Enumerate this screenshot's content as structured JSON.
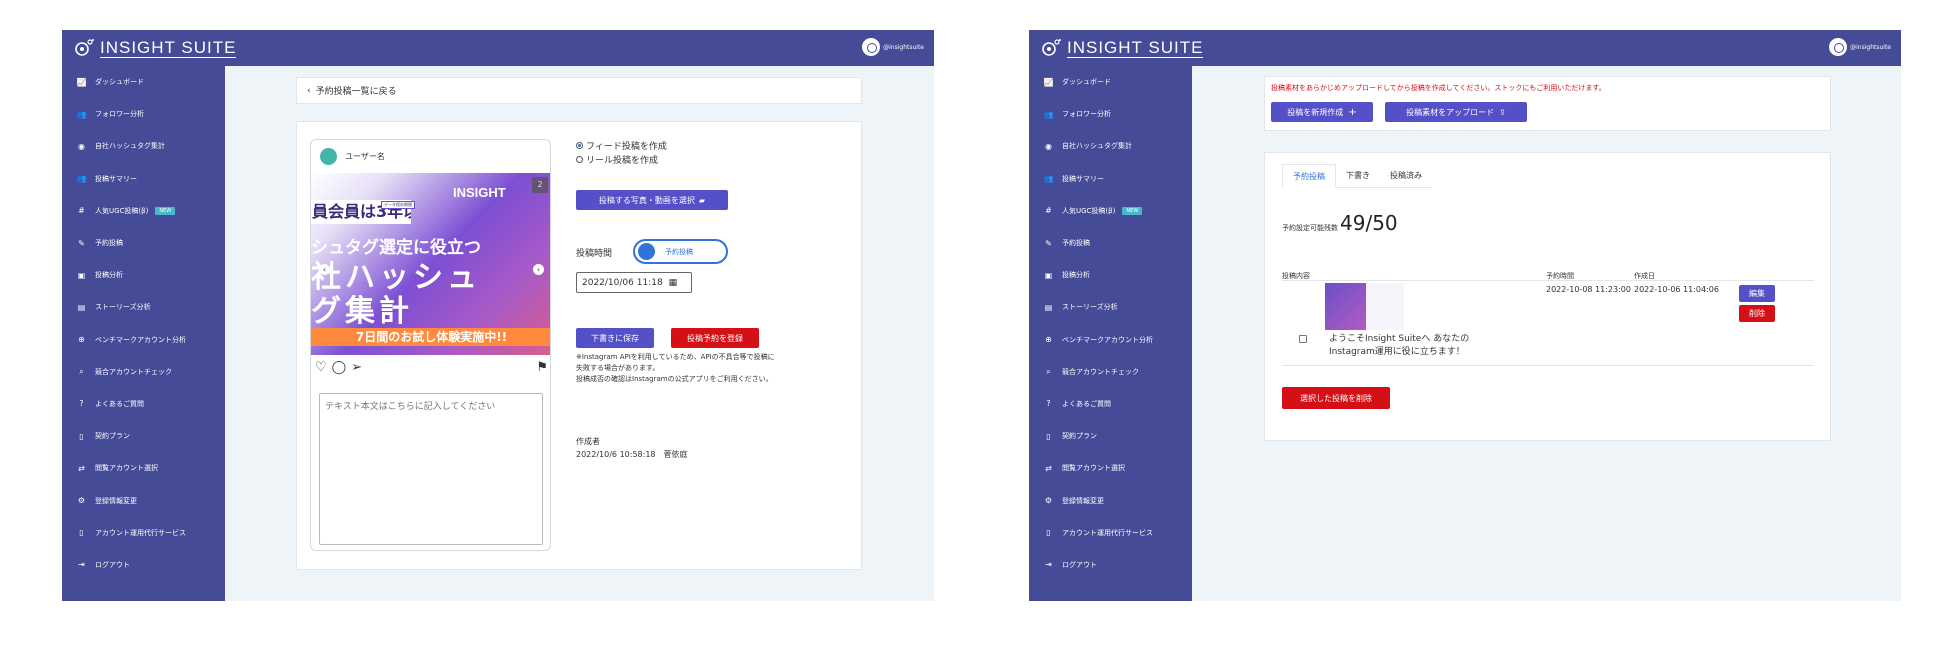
{
  "brand": {
    "logo_text": "INSIGHT SUITE",
    "username": "@insightsuite"
  },
  "colors": {
    "sidebar": "#454b96",
    "primary": "#5350c8",
    "danger": "#d40f16",
    "link": "#2f74d6",
    "bg": "#eef4f8"
  },
  "sidebar": {
    "items": [
      {
        "icon": "chart-line-icon",
        "label": "ダッシュボード"
      },
      {
        "icon": "users-icon",
        "label": "フォロワー分析"
      },
      {
        "icon": "user-circle-icon",
        "label": "自社ハッシュタグ集計"
      },
      {
        "icon": "users-icon",
        "label": "投稿サマリー"
      },
      {
        "icon": "hashtag-icon",
        "label": "人気UGC投稿(β)",
        "badge": "NEW"
      },
      {
        "icon": "edit-icon",
        "label": "予約投稿"
      },
      {
        "icon": "images-icon",
        "label": "投稿分析"
      },
      {
        "icon": "file-icon",
        "label": "ストーリーズ分析"
      },
      {
        "icon": "search-plus-icon",
        "label": "ベンチマークアカウント分析"
      },
      {
        "icon": "search-icon",
        "label": "競合アカウントチェック"
      },
      {
        "icon": "question-circle-icon",
        "label": "よくあるご質問"
      },
      {
        "icon": "file-contract-icon",
        "label": "契約プラン"
      },
      {
        "icon": "shuffle-icon",
        "label": "閲覧アカウント選択"
      },
      {
        "icon": "user-cog-icon",
        "label": "登録情報変更"
      },
      {
        "icon": "mobile-icon",
        "label": "アカウント運用代行サービス"
      },
      {
        "icon": "logout-icon",
        "label": "ログアウト"
      }
    ]
  },
  "editor": {
    "back_label": "予約投稿一覧に戻る",
    "preview": {
      "username": "ユーザー名",
      "image_counter": "2",
      "banner_top": "員会員は3年以上",
      "banner_tag": "データ保存期間",
      "banner_logo": "INSIGHT",
      "line1": "シュタグ選定に役立つ",
      "line2": "社ハッシュ",
      "line3": "グ集計",
      "bottom": "7日間のお試し体験実施中!!",
      "text_placeholder": "テキスト本文はこちらに記入してください"
    },
    "options": {
      "feed": "フィード投稿を作成",
      "reel": "リール投稿を作成"
    },
    "select_media": "投稿する写真・動画を選択",
    "post_time_label": "投稿時間",
    "toggle_label": "予約投稿",
    "datetime": "2022/10/06 11:18",
    "save_draft": "下書きに保存",
    "register": "投稿予約を登録",
    "note_lines": [
      "※Instagram APIを利用しているため、APIの不具合等で投稿に",
      "失敗する場合があります。",
      "投稿成否の確認はInstagramの公式アプリをご利用ください。"
    ],
    "creator_label": "作成者",
    "creator_info": "2022/10/6 10:58:18　菅依庭"
  },
  "list": {
    "warning": "投稿素材をあらかじめアップロードしてから投稿を作成してください。ストックにもご利用いただけます。",
    "new_post": "投稿を新規作成",
    "upload": "投稿素材をアップロード",
    "tabs": [
      "予約投稿",
      "下書き",
      "投稿済み"
    ],
    "quota_label": "予約設定可能残数",
    "quota_value": "49/50",
    "headers": {
      "content": "投稿内容",
      "scheduled": "予約時間",
      "created": "作成日"
    },
    "rows": [
      {
        "caption_line1": "ようこそInsight Suiteへ あなたの",
        "caption_line2": "Instagram運用に役に立ちます！",
        "scheduled": "2022-10-08 11:23:00",
        "created": "2022-10-06 11:04:06",
        "edit": "編集",
        "delete": "削除"
      }
    ],
    "delete_selected": "選択した投稿を削除"
  }
}
